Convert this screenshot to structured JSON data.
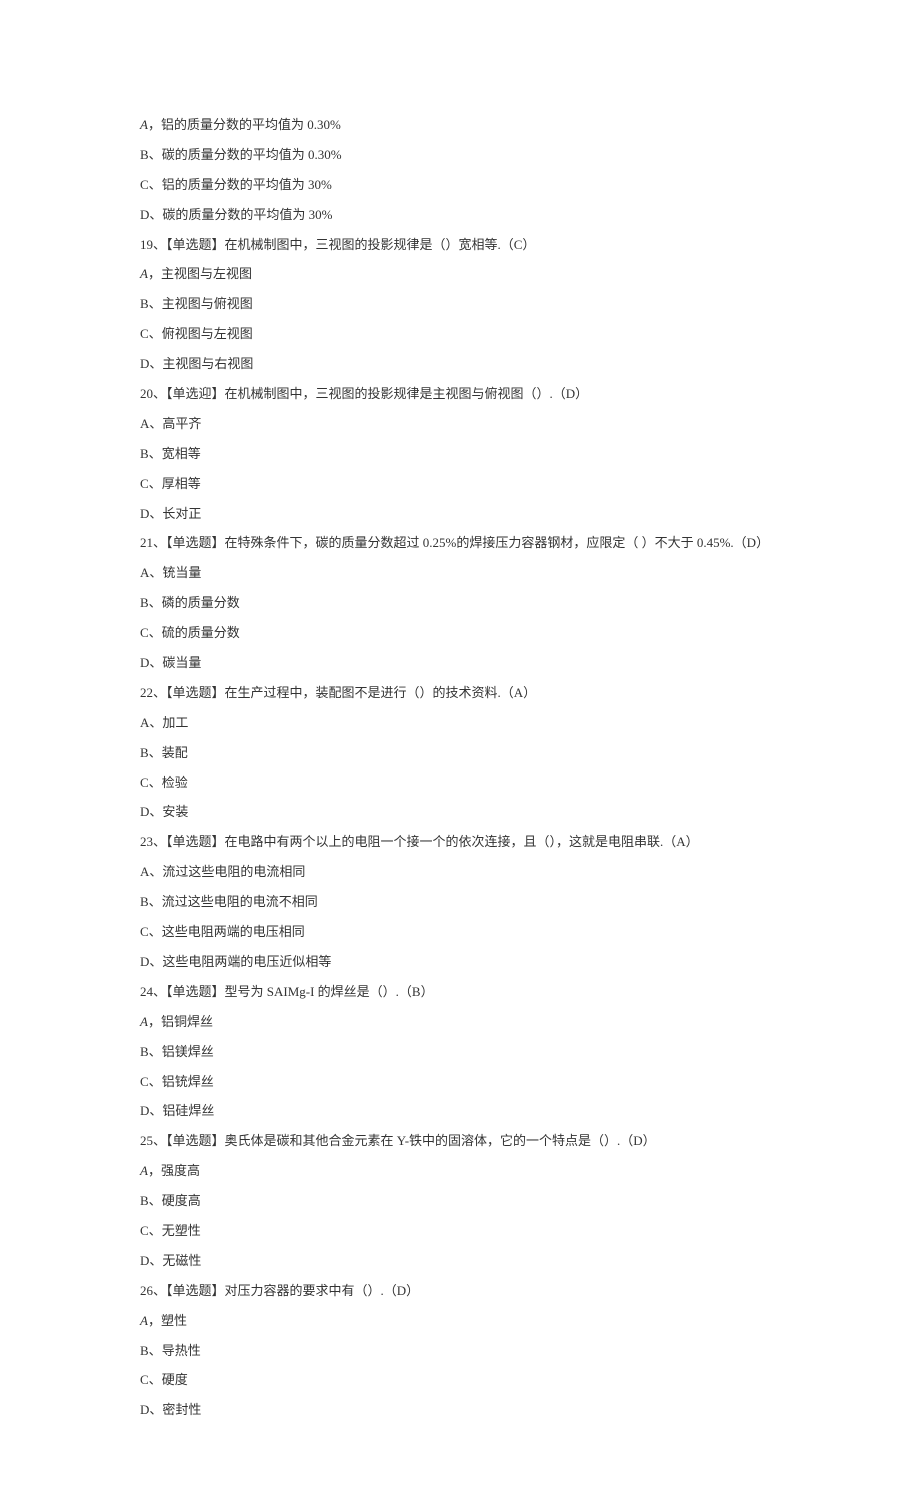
{
  "lines": [
    {
      "type": "option",
      "label": "A",
      "italic": true,
      "sep": "，",
      "text": "铝的质量分数的平均值为 0.30%"
    },
    {
      "type": "option",
      "label": "B",
      "italic": false,
      "sep": "、",
      "text": "碳的质量分数的平均值为 0.30%"
    },
    {
      "type": "option",
      "label": "C",
      "italic": false,
      "sep": "、",
      "text": "铝的质量分数的平均值为 30%"
    },
    {
      "type": "option",
      "label": "D",
      "italic": false,
      "sep": "、",
      "text": "碳的质量分数的平均值为 30%"
    },
    {
      "type": "question",
      "num": "19",
      "text": "【单选题】在机械制图中，三视图的投影规律是（）宽相等.（C）"
    },
    {
      "type": "option",
      "label": "A",
      "italic": true,
      "sep": "，",
      "text": "主视图与左视图"
    },
    {
      "type": "option",
      "label": "B",
      "italic": false,
      "sep": "、",
      "text": "主视图与俯视图"
    },
    {
      "type": "option",
      "label": "C",
      "italic": false,
      "sep": "、",
      "text": "俯视图与左视图"
    },
    {
      "type": "option",
      "label": "D",
      "italic": false,
      "sep": "、",
      "text": "主视图与右视图"
    },
    {
      "type": "question",
      "num": "20",
      "text": "【单选迎】在机械制图中，三视图的投影规律是主视图与俯视图（）.（D）"
    },
    {
      "type": "option",
      "label": "A",
      "italic": false,
      "sep": "、",
      "text": "高平齐"
    },
    {
      "type": "option",
      "label": "B",
      "italic": false,
      "sep": "、",
      "text": "宽相等"
    },
    {
      "type": "option",
      "label": "C",
      "italic": false,
      "sep": "、",
      "text": "厚相等"
    },
    {
      "type": "option",
      "label": "D",
      "italic": false,
      "sep": "、",
      "text": "长对正"
    },
    {
      "type": "question",
      "num": "21",
      "text": "【单选题】在特殊条件下，碳的质量分数超过 0.25%的焊接压力容器钢材，应限定（ ）不大于 0.45%.（D）"
    },
    {
      "type": "option",
      "label": "A",
      "italic": false,
      "sep": "、",
      "text": "铳当量"
    },
    {
      "type": "option",
      "label": "B",
      "italic": false,
      "sep": "、",
      "text": "磷的质量分数"
    },
    {
      "type": "option",
      "label": "C",
      "italic": false,
      "sep": "、",
      "text": "硫的质量分数"
    },
    {
      "type": "option",
      "label": "D",
      "italic": false,
      "sep": "、",
      "text": "碳当量"
    },
    {
      "type": "question",
      "num": "22",
      "text": "【单选题】在生产过程中，装配图不是进行（）的技术资料.（A）"
    },
    {
      "type": "option",
      "label": "A",
      "italic": false,
      "sep": "、",
      "text": "加工"
    },
    {
      "type": "option",
      "label": "B",
      "italic": false,
      "sep": "、",
      "text": "装配"
    },
    {
      "type": "option",
      "label": "C",
      "italic": false,
      "sep": "、",
      "text": "检验"
    },
    {
      "type": "option",
      "label": "D",
      "italic": false,
      "sep": "、",
      "text": "安装"
    },
    {
      "type": "question",
      "num": "23",
      "text": "【单选题】在电路中有两个以上的电阻一个接一个的依次连接，且（），这就是电阻串联.（A）"
    },
    {
      "type": "option",
      "label": "A",
      "italic": false,
      "sep": "、",
      "text": "流过这些电阻的电流相同"
    },
    {
      "type": "option",
      "label": "B",
      "italic": false,
      "sep": "、",
      "text": "流过这些电阻的电流不相同"
    },
    {
      "type": "option",
      "label": "C",
      "italic": false,
      "sep": "、",
      "text": "这些电阻两端的电压相同"
    },
    {
      "type": "option",
      "label": "D",
      "italic": false,
      "sep": "、",
      "text": "这些电阻两端的电压近似相等"
    },
    {
      "type": "question",
      "num": "24",
      "text": "【单选题】型号为 SAIMg-I 的焊丝是（）.（B）"
    },
    {
      "type": "option",
      "label": "A",
      "italic": true,
      "sep": "，",
      "text": "铝铜焊丝"
    },
    {
      "type": "option",
      "label": "B",
      "italic": false,
      "sep": "、",
      "text": "铝镁焊丝"
    },
    {
      "type": "option",
      "label": "C",
      "italic": false,
      "sep": "、",
      "text": "铝铳焊丝"
    },
    {
      "type": "option",
      "label": "D",
      "italic": false,
      "sep": "、",
      "text": "铝硅焊丝"
    },
    {
      "type": "question",
      "num": "25",
      "text": "【单选题】奥氏体是碳和其他合金元素在 Y-铁中的固溶体，它的一个特点是（）.（D）"
    },
    {
      "type": "option",
      "label": "A",
      "italic": true,
      "sep": "，",
      "text": "强度高"
    },
    {
      "type": "option",
      "label": "B",
      "italic": false,
      "sep": "、",
      "text": "硬度高"
    },
    {
      "type": "option",
      "label": "C",
      "italic": false,
      "sep": "、",
      "text": "无塑性"
    },
    {
      "type": "option",
      "label": "D",
      "italic": false,
      "sep": "、",
      "text": "无磁性"
    },
    {
      "type": "question",
      "num": "26",
      "text": "【单选题】对压力容器的要求中有（）.（D）"
    },
    {
      "type": "option",
      "label": "A",
      "italic": true,
      "sep": "，",
      "text": "塑性"
    },
    {
      "type": "option",
      "label": "B",
      "italic": false,
      "sep": "、",
      "text": "导热性"
    },
    {
      "type": "option",
      "label": "C",
      "italic": false,
      "sep": "、",
      "text": "硬度"
    },
    {
      "type": "option",
      "label": "D",
      "italic": false,
      "sep": "、",
      "text": "密封性"
    }
  ]
}
